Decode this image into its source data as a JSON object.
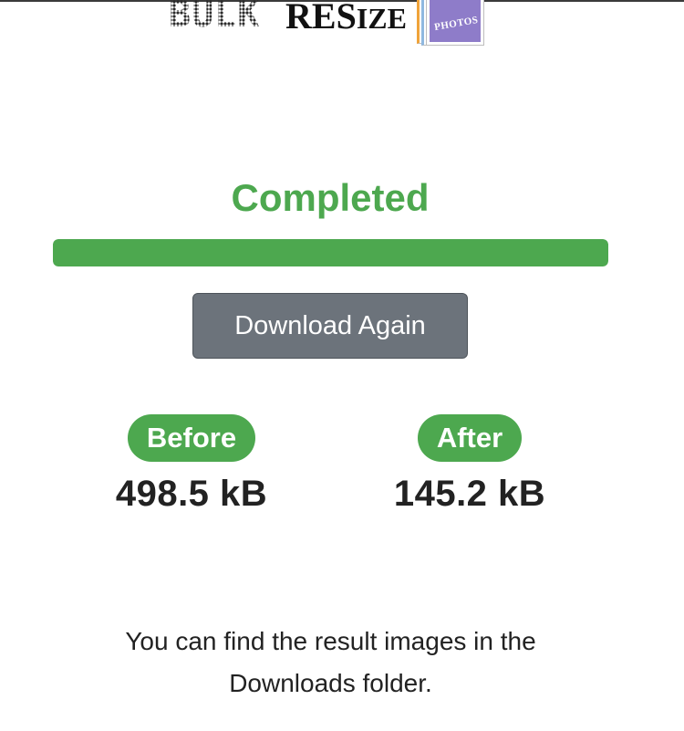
{
  "logo": {
    "bulk_text": "BULK",
    "resize_text_main": "RES",
    "resize_text_small": "IZE",
    "photos_label": "PHOTOS"
  },
  "status": {
    "title": "Completed",
    "progress_percent": 100
  },
  "actions": {
    "download_label": "Download Again"
  },
  "stats": {
    "before": {
      "label": "Before",
      "value": "498.5 kB"
    },
    "after": {
      "label": "After",
      "value": "145.2 kB"
    }
  },
  "note": {
    "line1": "You can find the result images in the",
    "line2": "Downloads folder."
  },
  "colors": {
    "accent_green": "#4da84f",
    "button_gray": "#6c737b",
    "text_dark": "#222222"
  }
}
